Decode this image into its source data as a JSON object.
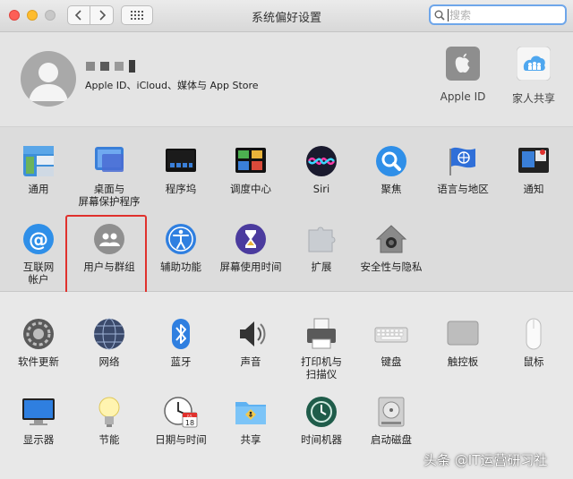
{
  "window": {
    "title": "系统偏好设置"
  },
  "search": {
    "placeholder": "搜索"
  },
  "account": {
    "subtitle": "Apple ID、iCloud、媒体与 App Store",
    "apple_id_label": "Apple ID",
    "family_label": "家人共享"
  },
  "section1": {
    "items": [
      {
        "label": "通用",
        "icon": "general-icon"
      },
      {
        "label": "桌面与\n屏幕保护程序",
        "icon": "desktop-screensaver-icon"
      },
      {
        "label": "程序坞",
        "icon": "dock-icon"
      },
      {
        "label": "调度中心",
        "icon": "mission-control-icon"
      },
      {
        "label": "Siri",
        "icon": "siri-icon"
      },
      {
        "label": "聚焦",
        "icon": "spotlight-icon"
      },
      {
        "label": "语言与地区",
        "icon": "language-region-icon"
      },
      {
        "label": "通知",
        "icon": "notifications-icon"
      },
      {
        "label": "互联网\n帐户",
        "icon": "internet-accounts-icon"
      },
      {
        "label": "用户与群组",
        "icon": "users-groups-icon"
      },
      {
        "label": "辅助功能",
        "icon": "accessibility-icon"
      },
      {
        "label": "屏幕使用时间",
        "icon": "screen-time-icon"
      },
      {
        "label": "扩展",
        "icon": "extensions-icon"
      },
      {
        "label": "安全性与隐私",
        "icon": "security-privacy-icon"
      }
    ]
  },
  "section2": {
    "items": [
      {
        "label": "软件更新",
        "icon": "software-update-icon"
      },
      {
        "label": "网络",
        "icon": "network-icon"
      },
      {
        "label": "蓝牙",
        "icon": "bluetooth-icon"
      },
      {
        "label": "声音",
        "icon": "sound-icon"
      },
      {
        "label": "打印机与\n扫描仪",
        "icon": "printers-scanners-icon"
      },
      {
        "label": "键盘",
        "icon": "keyboard-icon"
      },
      {
        "label": "触控板",
        "icon": "trackpad-icon"
      },
      {
        "label": "鼠标",
        "icon": "mouse-icon"
      },
      {
        "label": "显示器",
        "icon": "displays-icon"
      },
      {
        "label": "节能",
        "icon": "energy-saver-icon"
      },
      {
        "label": "日期与时间",
        "icon": "date-time-icon"
      },
      {
        "label": "共享",
        "icon": "sharing-icon"
      },
      {
        "label": "时间机器",
        "icon": "time-machine-icon"
      },
      {
        "label": "启动磁盘",
        "icon": "startup-disk-icon"
      }
    ]
  },
  "date_icon": {
    "month": "JUL",
    "day": "18"
  },
  "watermark": "头条 @IT运营研习社",
  "colors": {
    "highlight": "#e0312d",
    "search_focus": "#6ea6ea"
  }
}
